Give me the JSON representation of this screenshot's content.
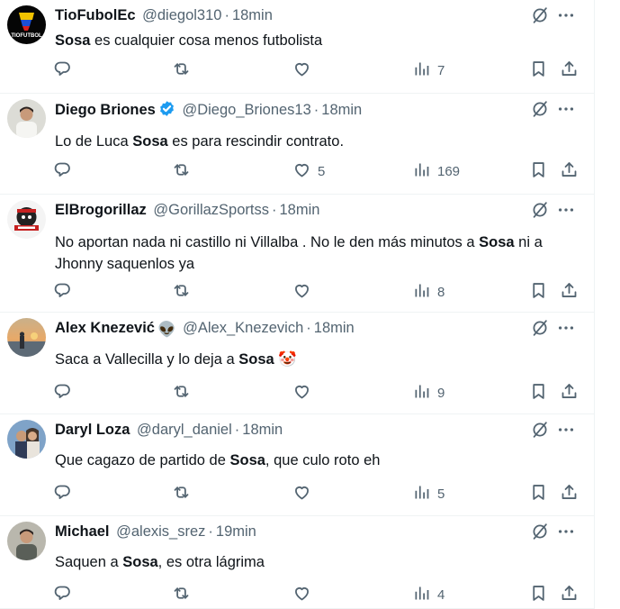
{
  "tweets": [
    {
      "name": "TioFubolEc",
      "handle": "@diegol310",
      "time": "18min",
      "text_parts": [
        {
          "t": "Sosa",
          "bold": true
        },
        {
          "t": " es cualquier cosa menos futbolista",
          "bold": false
        }
      ],
      "verified": false,
      "emoji": "",
      "avatar": "tiofutbol-logo",
      "avatar_text": "TIOFUTBOL",
      "likes": "",
      "views": "7"
    },
    {
      "name": "Diego Briones",
      "handle": "@Diego_Briones13",
      "time": "18min",
      "text_parts": [
        {
          "t": "Lo de Luca ",
          "bold": false
        },
        {
          "t": "Sosa",
          "bold": true
        },
        {
          "t": " es para rescindir contrato.",
          "bold": false
        }
      ],
      "verified": true,
      "emoji": "",
      "avatar": "person-photo",
      "likes": "5",
      "views": "169"
    },
    {
      "name": "ElBrogorillaz",
      "handle": "@GorillazSportss",
      "time": "18min",
      "text_parts": [
        {
          "t": "No aportan nada ni castillo ni Villalba . No le den más minutos a ",
          "bold": false
        },
        {
          "t": "Sosa",
          "bold": true
        },
        {
          "t": " ni a Jhonny saquenlos ya",
          "bold": false
        }
      ],
      "verified": false,
      "emoji": "",
      "avatar": "gorilla-logo",
      "likes": "",
      "views": "8"
    },
    {
      "name": "Alex Knezević",
      "handle": "@Alex_Knezevich",
      "time": "18min",
      "text_parts": [
        {
          "t": "Saca a Vallecilla y lo deja a ",
          "bold": false
        },
        {
          "t": "Sosa",
          "bold": true
        },
        {
          "t": " 🤡",
          "bold": false
        }
      ],
      "verified": false,
      "emoji": "👽",
      "avatar": "sunset-photo",
      "likes": "",
      "views": "9"
    },
    {
      "name": "Daryl Loza",
      "handle": "@daryl_daniel",
      "time": "18min",
      "text_parts": [
        {
          "t": "Que cagazo de partido de ",
          "bold": false
        },
        {
          "t": "Sosa",
          "bold": true
        },
        {
          "t": ", que culo roto eh",
          "bold": false
        }
      ],
      "verified": false,
      "emoji": "",
      "avatar": "couple-photo",
      "likes": "",
      "views": "5"
    },
    {
      "name": "Michael",
      "handle": "@alexis_srez",
      "time": "19min",
      "text_parts": [
        {
          "t": "Saquen a ",
          "bold": false
        },
        {
          "t": "Sosa",
          "bold": true
        },
        {
          "t": ", es otra lágrima",
          "bold": false
        }
      ],
      "verified": false,
      "emoji": "",
      "avatar": "person-photo",
      "likes": "",
      "views": "4"
    }
  ],
  "colors": {
    "text": "#0f1419",
    "secondary": "#536471",
    "verified": "#1d9bf0",
    "divider": "#eff3f4"
  },
  "icons": [
    "grok-icon",
    "more-icon",
    "reply-icon",
    "retweet-icon",
    "like-icon",
    "views-icon",
    "bookmark-icon",
    "share-icon",
    "verified-badge-icon"
  ]
}
